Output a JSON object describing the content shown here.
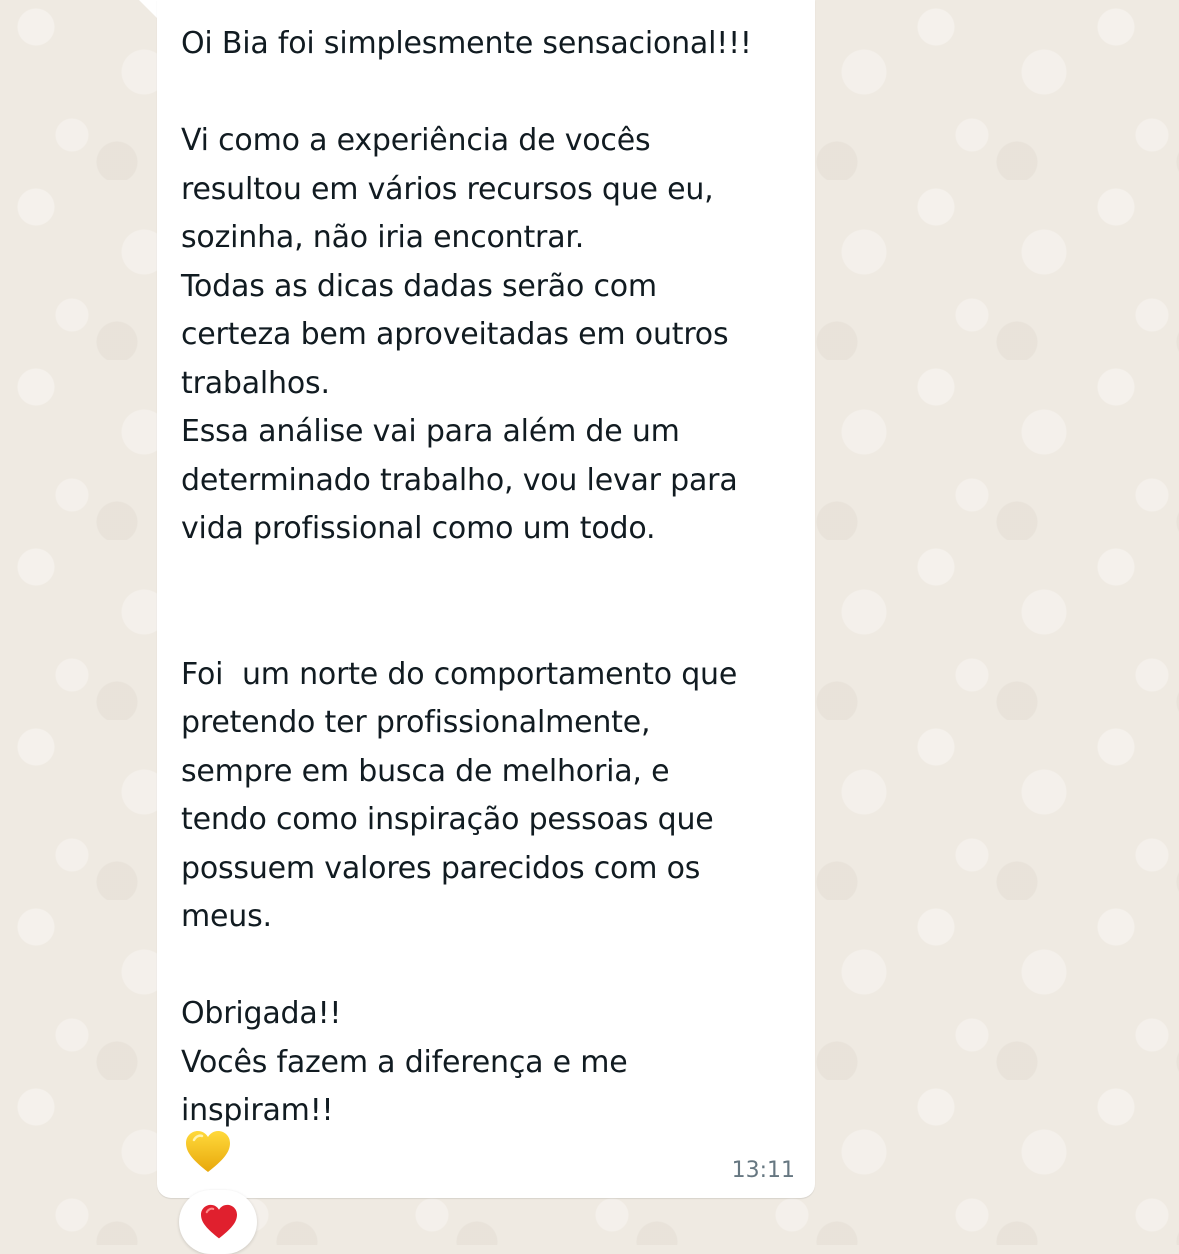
{
  "chat": {
    "message": {
      "text": "Oi Bia foi simplesmente sensacional!!!\n\nVi como a experiência de vocês\nresultou em vários recursos que eu,\nsozinha, não iria encontrar.\nTodas as dicas dadas serão com\ncerteza bem aproveitadas em outros\ntrabalhos.\nEssa análise vai para além de um\ndeterminado trabalho, vou levar para\nvida profissional como um todo.\n\n\nFoi  um norte do comportamento que\npretendo ter profissionalmente,\nsempre em busca de melhoria, e\ntendo como inspiração pessoas que\npossuem valores parecidos com os\nmeus.\n\nObrigada!!\nVocês fazem a diferença e me\ninspiram!!",
      "trailing_emoji": "yellow-heart",
      "time": "13:11",
      "reaction_emoji": "red-heart"
    }
  },
  "colors": {
    "chat_background": "#efeae2",
    "bubble": "#ffffff",
    "text": "#111b21",
    "timestamp": "#667781",
    "yellow_heart": "#f7c62f",
    "red_heart": "#e0202e"
  }
}
